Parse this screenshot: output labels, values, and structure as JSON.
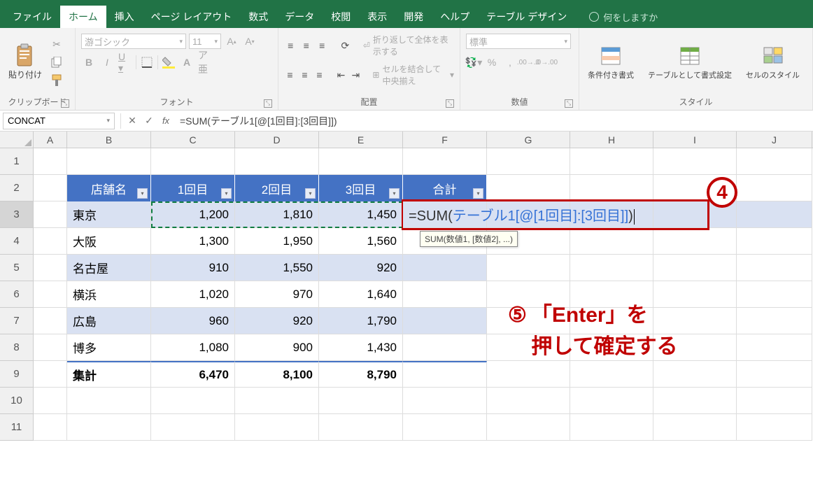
{
  "tabs": {
    "file": "ファイル",
    "home": "ホーム",
    "insert": "挿入",
    "pagelayout": "ページ レイアウト",
    "formulas": "数式",
    "data": "データ",
    "review": "校閲",
    "view": "表示",
    "developer": "開発",
    "help": "ヘルプ",
    "tabledesign": "テーブル デザイン",
    "tellme": "何をしますか"
  },
  "ribbon": {
    "clipboard": {
      "paste": "貼り付け",
      "label": "クリップボード"
    },
    "font": {
      "family": "游ゴシック",
      "size": "11",
      "label": "フォント"
    },
    "align": {
      "wrap": "折り返して全体を表示する",
      "merge": "セルを結合して中央揃え",
      "label": "配置"
    },
    "number": {
      "format": "標準",
      "label": "数値"
    },
    "styles": {
      "cond": "条件付き書式",
      "astable": "テーブルとして書式設定",
      "cellstyles": "セルのスタイル",
      "label": "スタイル"
    }
  },
  "formula_bar": {
    "namebox": "CONCAT",
    "formula": "=SUM(テーブル1[@[1回目]:[3回目]])"
  },
  "columns": [
    "A",
    "B",
    "C",
    "D",
    "E",
    "F",
    "G",
    "H",
    "I",
    "J"
  ],
  "rownums": [
    "1",
    "2",
    "3",
    "4",
    "5",
    "6",
    "7",
    "8",
    "9",
    "10",
    "11"
  ],
  "headers": {
    "b": "店舗名",
    "c": "1回目",
    "d": "2回目",
    "e": "3回目",
    "f": "合計"
  },
  "rows": [
    {
      "b": "東京",
      "c": "1,200",
      "d": "1,810",
      "e": "1,450"
    },
    {
      "b": "大阪",
      "c": "1,300",
      "d": "1,950",
      "e": "1,560"
    },
    {
      "b": "名古屋",
      "c": "910",
      "d": "1,550",
      "e": "920"
    },
    {
      "b": "横浜",
      "c": "1,020",
      "d": "970",
      "e": "1,640"
    },
    {
      "b": "広島",
      "c": "960",
      "d": "920",
      "e": "1,790"
    },
    {
      "b": "博多",
      "c": "1,080",
      "d": "900",
      "e": "1,430"
    }
  ],
  "totals": {
    "b": "集計",
    "c": "6,470",
    "d": "8,100",
    "e": "8,790"
  },
  "editing": {
    "prefix": "=SUM(",
    "ref": "テーブル1[@[1回目]:[3回目]]",
    "suffix": ")",
    "hint": "SUM(数値1, [数値2], ...)"
  },
  "callouts": {
    "n4": "4",
    "n5": "⑤",
    "text": "「Enter」を\n押して確定する"
  },
  "chart_data": {
    "type": "table",
    "columns": [
      "店舗名",
      "1回目",
      "2回目",
      "3回目"
    ],
    "rows": [
      [
        "東京",
        1200,
        1810,
        1450
      ],
      [
        "大阪",
        1300,
        1950,
        1560
      ],
      [
        "名古屋",
        910,
        1550,
        920
      ],
      [
        "横浜",
        1020,
        970,
        1640
      ],
      [
        "広島",
        960,
        920,
        1790
      ],
      [
        "博多",
        1080,
        900,
        1430
      ]
    ],
    "totals": [
      "集計",
      6470,
      8100,
      8790
    ]
  }
}
